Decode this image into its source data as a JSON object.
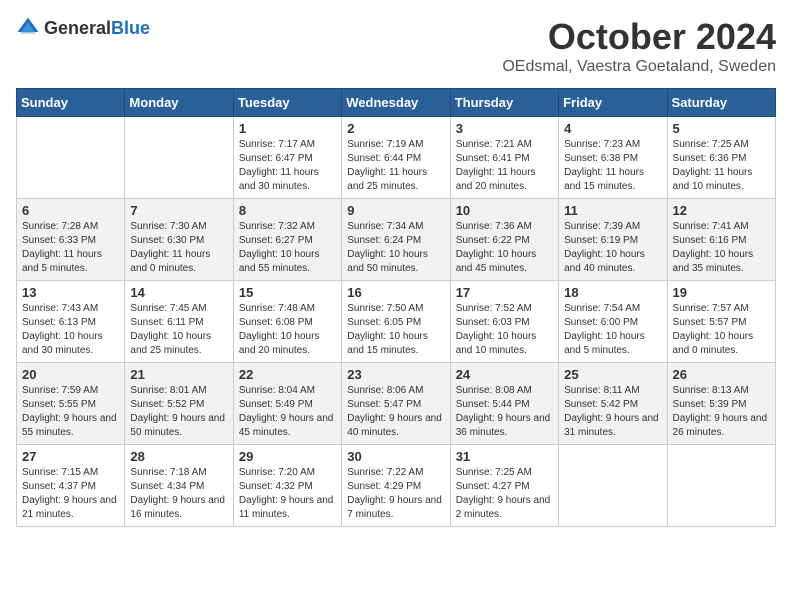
{
  "header": {
    "logo_general": "General",
    "logo_blue": "Blue",
    "month": "October 2024",
    "location": "OEdsmal, Vaestra Goetaland, Sweden"
  },
  "weekdays": [
    "Sunday",
    "Monday",
    "Tuesday",
    "Wednesday",
    "Thursday",
    "Friday",
    "Saturday"
  ],
  "weeks": [
    [
      {
        "day": "",
        "detail": ""
      },
      {
        "day": "",
        "detail": ""
      },
      {
        "day": "1",
        "detail": "Sunrise: 7:17 AM\nSunset: 6:47 PM\nDaylight: 11 hours and 30 minutes."
      },
      {
        "day": "2",
        "detail": "Sunrise: 7:19 AM\nSunset: 6:44 PM\nDaylight: 11 hours and 25 minutes."
      },
      {
        "day": "3",
        "detail": "Sunrise: 7:21 AM\nSunset: 6:41 PM\nDaylight: 11 hours and 20 minutes."
      },
      {
        "day": "4",
        "detail": "Sunrise: 7:23 AM\nSunset: 6:38 PM\nDaylight: 11 hours and 15 minutes."
      },
      {
        "day": "5",
        "detail": "Sunrise: 7:25 AM\nSunset: 6:36 PM\nDaylight: 11 hours and 10 minutes."
      }
    ],
    [
      {
        "day": "6",
        "detail": "Sunrise: 7:28 AM\nSunset: 6:33 PM\nDaylight: 11 hours and 5 minutes."
      },
      {
        "day": "7",
        "detail": "Sunrise: 7:30 AM\nSunset: 6:30 PM\nDaylight: 11 hours and 0 minutes."
      },
      {
        "day": "8",
        "detail": "Sunrise: 7:32 AM\nSunset: 6:27 PM\nDaylight: 10 hours and 55 minutes."
      },
      {
        "day": "9",
        "detail": "Sunrise: 7:34 AM\nSunset: 6:24 PM\nDaylight: 10 hours and 50 minutes."
      },
      {
        "day": "10",
        "detail": "Sunrise: 7:36 AM\nSunset: 6:22 PM\nDaylight: 10 hours and 45 minutes."
      },
      {
        "day": "11",
        "detail": "Sunrise: 7:39 AM\nSunset: 6:19 PM\nDaylight: 10 hours and 40 minutes."
      },
      {
        "day": "12",
        "detail": "Sunrise: 7:41 AM\nSunset: 6:16 PM\nDaylight: 10 hours and 35 minutes."
      }
    ],
    [
      {
        "day": "13",
        "detail": "Sunrise: 7:43 AM\nSunset: 6:13 PM\nDaylight: 10 hours and 30 minutes."
      },
      {
        "day": "14",
        "detail": "Sunrise: 7:45 AM\nSunset: 6:11 PM\nDaylight: 10 hours and 25 minutes."
      },
      {
        "day": "15",
        "detail": "Sunrise: 7:48 AM\nSunset: 6:08 PM\nDaylight: 10 hours and 20 minutes."
      },
      {
        "day": "16",
        "detail": "Sunrise: 7:50 AM\nSunset: 6:05 PM\nDaylight: 10 hours and 15 minutes."
      },
      {
        "day": "17",
        "detail": "Sunrise: 7:52 AM\nSunset: 6:03 PM\nDaylight: 10 hours and 10 minutes."
      },
      {
        "day": "18",
        "detail": "Sunrise: 7:54 AM\nSunset: 6:00 PM\nDaylight: 10 hours and 5 minutes."
      },
      {
        "day": "19",
        "detail": "Sunrise: 7:57 AM\nSunset: 5:57 PM\nDaylight: 10 hours and 0 minutes."
      }
    ],
    [
      {
        "day": "20",
        "detail": "Sunrise: 7:59 AM\nSunset: 5:55 PM\nDaylight: 9 hours and 55 minutes."
      },
      {
        "day": "21",
        "detail": "Sunrise: 8:01 AM\nSunset: 5:52 PM\nDaylight: 9 hours and 50 minutes."
      },
      {
        "day": "22",
        "detail": "Sunrise: 8:04 AM\nSunset: 5:49 PM\nDaylight: 9 hours and 45 minutes."
      },
      {
        "day": "23",
        "detail": "Sunrise: 8:06 AM\nSunset: 5:47 PM\nDaylight: 9 hours and 40 minutes."
      },
      {
        "day": "24",
        "detail": "Sunrise: 8:08 AM\nSunset: 5:44 PM\nDaylight: 9 hours and 36 minutes."
      },
      {
        "day": "25",
        "detail": "Sunrise: 8:11 AM\nSunset: 5:42 PM\nDaylight: 9 hours and 31 minutes."
      },
      {
        "day": "26",
        "detail": "Sunrise: 8:13 AM\nSunset: 5:39 PM\nDaylight: 9 hours and 26 minutes."
      }
    ],
    [
      {
        "day": "27",
        "detail": "Sunrise: 7:15 AM\nSunset: 4:37 PM\nDaylight: 9 hours and 21 minutes."
      },
      {
        "day": "28",
        "detail": "Sunrise: 7:18 AM\nSunset: 4:34 PM\nDaylight: 9 hours and 16 minutes."
      },
      {
        "day": "29",
        "detail": "Sunrise: 7:20 AM\nSunset: 4:32 PM\nDaylight: 9 hours and 11 minutes."
      },
      {
        "day": "30",
        "detail": "Sunrise: 7:22 AM\nSunset: 4:29 PM\nDaylight: 9 hours and 7 minutes."
      },
      {
        "day": "31",
        "detail": "Sunrise: 7:25 AM\nSunset: 4:27 PM\nDaylight: 9 hours and 2 minutes."
      },
      {
        "day": "",
        "detail": ""
      },
      {
        "day": "",
        "detail": ""
      }
    ]
  ]
}
